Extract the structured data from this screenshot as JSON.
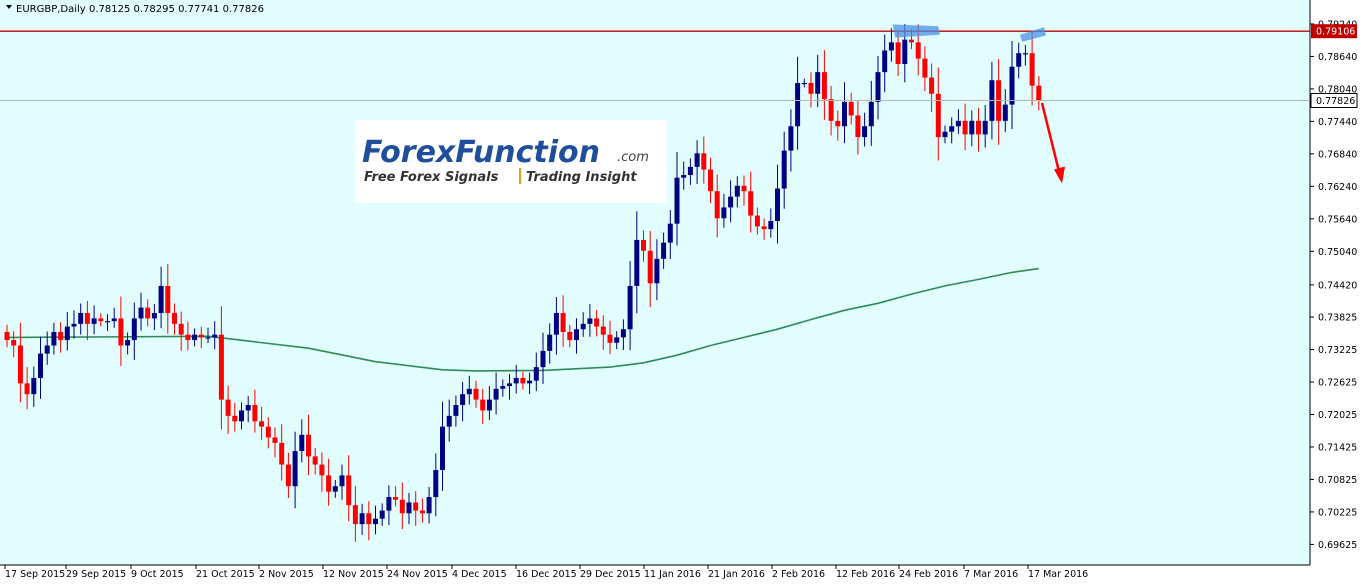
{
  "chart_data": {
    "type": "candlestick",
    "symbol_label": "EURGBP,Daily",
    "ohlc_label": "0.78125 0.78295 0.77741 0.77826",
    "ylim": [
      0.693,
      0.7935
    ],
    "y_ticks": [
      "0.79240",
      "0.78640",
      "0.78040",
      "0.77440",
      "0.76840",
      "0.76240",
      "0.75640",
      "0.75040",
      "0.74420",
      "0.73825",
      "0.73225",
      "0.72625",
      "0.72025",
      "0.71425",
      "0.70825",
      "0.70225",
      "0.69625"
    ],
    "x_ticks": [
      "17 Sep 2015",
      "29 Sep 2015",
      "9 Oct 2015",
      "21 Oct 2015",
      "2 Nov 2015",
      "12 Nov 2015",
      "24 Nov 2015",
      "4 Dec 2015",
      "16 Dec 2015",
      "29 Dec 2015",
      "11 Jan 2016",
      "21 Jan 2016",
      "2 Feb 2016",
      "12 Feb 2016",
      "24 Feb 2016",
      "7 Mar 2016",
      "17 Mar 2016"
    ],
    "resistance_level": 0.79106,
    "resistance_label": "0.79106",
    "current_price": 0.77826,
    "current_price_label": "0.77826",
    "colors": {
      "background": "#e1fdfd",
      "bull": "#000080",
      "bear": "#ff0000",
      "moving_average": "#2e8b57",
      "resistance": "#c00000",
      "current_line": "#b4b4b4",
      "highlight": "#4a90e2",
      "arrow": "#ff0000"
    },
    "closes": [
      0.734,
      0.733,
      0.726,
      0.724,
      0.727,
      0.7315,
      0.733,
      0.7355,
      0.734,
      0.7365,
      0.737,
      0.739,
      0.737,
      0.738,
      0.7375,
      0.7375,
      0.738,
      0.733,
      0.734,
      0.738,
      0.74,
      0.738,
      0.739,
      0.744,
      0.739,
      0.737,
      0.735,
      0.734,
      0.735,
      0.7345,
      0.7345,
      0.735,
      0.723,
      0.72,
      0.719,
      0.721,
      0.722,
      0.719,
      0.718,
      0.716,
      0.715,
      0.711,
      0.707,
      0.7135,
      0.7165,
      0.7125,
      0.711,
      0.709,
      0.706,
      0.707,
      0.709,
      0.7035,
      0.7,
      0.702,
      0.7,
      0.701,
      0.7025,
      0.705,
      0.7045,
      0.702,
      0.704,
      0.7025,
      0.702,
      0.705,
      0.71,
      0.718,
      0.72,
      0.722,
      0.724,
      0.725,
      0.723,
      0.721,
      0.723,
      0.725,
      0.7255,
      0.726,
      0.727,
      0.726,
      0.7265,
      0.729,
      0.732,
      0.735,
      0.739,
      0.7355,
      0.734,
      0.736,
      0.737,
      0.738,
      0.7365,
      0.735,
      0.7335,
      0.7345,
      0.736,
      0.744,
      0.7525,
      0.7505,
      0.7445,
      0.749,
      0.752,
      0.7555,
      0.764,
      0.7645,
      0.766,
      0.7685,
      0.7655,
      0.7615,
      0.7565,
      0.7585,
      0.7605,
      0.7625,
      0.7615,
      0.757,
      0.755,
      0.7545,
      0.756,
      0.762,
      0.769,
      0.7735,
      0.7815,
      0.7815,
      0.7795,
      0.7835,
      0.7785,
      0.7745,
      0.7735,
      0.778,
      0.7755,
      0.7715,
      0.7735,
      0.778,
      0.7835,
      0.7875,
      0.789,
      0.785,
      0.7895,
      0.789,
      0.786,
      0.7825,
      0.7795,
      0.7715,
      0.7725,
      0.7735,
      0.7745,
      0.772,
      0.7745,
      0.772,
      0.7745,
      0.782,
      0.7745,
      0.7775,
      0.7845,
      0.787,
      0.787,
      0.781,
      0.7782
    ],
    "ma_points": [
      [
        0,
        0.7345
      ],
      [
        30,
        0.7347
      ],
      [
        45,
        0.7325
      ],
      [
        55,
        0.73
      ],
      [
        65,
        0.7285
      ],
      [
        70,
        0.7283
      ],
      [
        80,
        0.7284
      ],
      [
        90,
        0.729
      ],
      [
        95,
        0.7298
      ],
      [
        100,
        0.7312
      ],
      [
        105,
        0.733
      ],
      [
        110,
        0.7345
      ],
      [
        115,
        0.736
      ],
      [
        120,
        0.7378
      ],
      [
        125,
        0.7395
      ],
      [
        130,
        0.7408
      ],
      [
        135,
        0.7425
      ],
      [
        140,
        0.744
      ],
      [
        145,
        0.7452
      ],
      [
        150,
        0.7465
      ],
      [
        154,
        0.7472
      ]
    ],
    "logo": {
      "name_part1": "Forex",
      "name_part2": "Function",
      "name_suffix": ".com",
      "tagline_left": "Free Forex Signals",
      "tagline_right": "Trading Insight"
    }
  }
}
